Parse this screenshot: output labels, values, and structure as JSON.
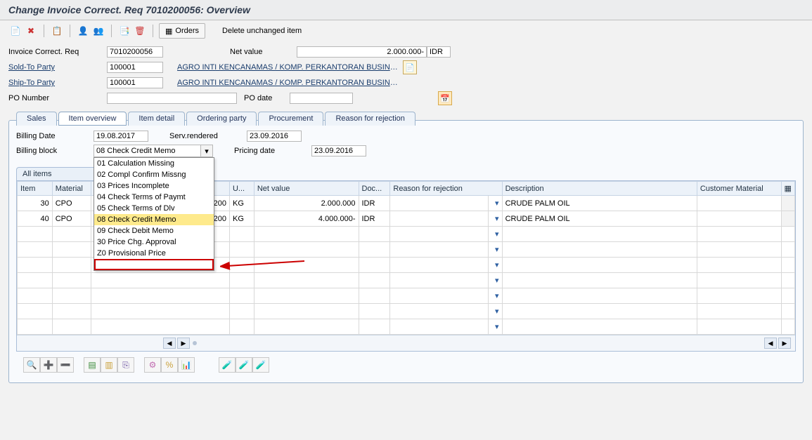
{
  "title": "Change Invoice Correct. Req 7010200056: Overview",
  "toolbar": {
    "orders_label": "Orders",
    "delete_label": "Delete unchanged item"
  },
  "header": {
    "doc_type_label": "Invoice Correct. Req",
    "doc_number": "7010200056",
    "net_value_label": "Net value",
    "net_value": "2.000.000-",
    "net_value_unit": "IDR",
    "sold_to_label": "Sold-To Party",
    "sold_to": "100001",
    "sold_to_desc": "AGRO INTI KENCANAMAS / KOMP. PERKANTORAN BUSINESS ...",
    "ship_to_label": "Ship-To Party",
    "ship_to": "100001",
    "ship_to_desc": "AGRO INTI KENCANAMAS / KOMP. PERKANTORAN BUSINESS ...",
    "po_number_label": "PO Number",
    "po_number": "",
    "po_date_label": "PO date",
    "po_date": ""
  },
  "tabs": [
    "Sales",
    "Item overview",
    "Item detail",
    "Ordering party",
    "Procurement",
    "Reason for rejection"
  ],
  "active_tab": 1,
  "item_overview": {
    "billing_date_label": "Billing Date",
    "billing_date": "19.08.2017",
    "billing_block_label": "Billing block",
    "billing_block_value": "08 Check Credit Memo",
    "billing_block_options": [
      "01 Calculation Missing",
      "02 Compl Confirm Missng",
      "03 Prices Incomplete",
      "04 Check Terms of Paymt",
      "05 Check Terms of Dlv",
      "08 Check Credit Memo",
      "09 Check Debit Memo",
      "30 Price Chg. Approval",
      "Z0 Provisional Price",
      ""
    ],
    "billing_block_selected_index": 5,
    "serv_rendered_label": "Serv.rendered",
    "serv_rendered": "23.09.2016",
    "pricing_date_label": "Pricing date",
    "pricing_date": "23.09.2016",
    "all_items_label": "All items",
    "columns": [
      "Item",
      "Material",
      "",
      "U...",
      "Net value",
      "Doc...",
      "Reason for rejection",
      "Description",
      "Customer Material"
    ],
    "rows": [
      {
        "item": "30",
        "material": "CPO",
        "qty": "200",
        "uom": "KG",
        "net_value": "2.000.000",
        "doc_curr": "IDR",
        "reason": "",
        "description": "CRUDE PALM OIL",
        "cust_mat": ""
      },
      {
        "item": "40",
        "material": "CPO",
        "qty": "200",
        "uom": "KG",
        "net_value": "4.000.000-",
        "doc_curr": "IDR",
        "reason": "",
        "description": "CRUDE PALM OIL",
        "cust_mat": ""
      }
    ]
  }
}
